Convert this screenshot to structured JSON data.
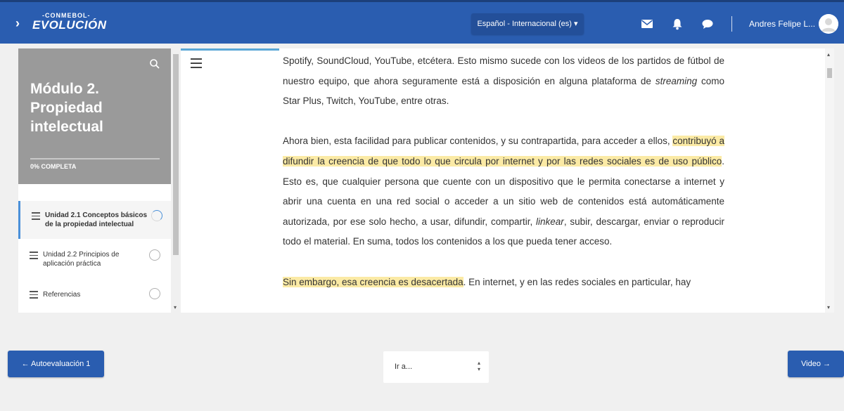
{
  "header": {
    "logo_top": "-CONMEBOL-",
    "logo_main": "EVOLUCIÓN",
    "collapse_icon": "›",
    "language": "Español - Internacional (es)",
    "language_caret": "▾",
    "username": "Andres Felipe L...",
    "icons": [
      "mail-icon",
      "bell-icon",
      "chat-icon"
    ],
    "brand_color": "#2a5db0"
  },
  "sidebar": {
    "title": "Módulo 2. Propiedad intelectual",
    "progress_label": "0% COMPLETA",
    "progress": 0,
    "items": [
      {
        "label": "Unidad 2.1 Conceptos básicos de la propiedad intelectual",
        "active": true,
        "status": "in-progress"
      },
      {
        "label": "Unidad 2.2 Principios de aplicación práctica",
        "active": false,
        "status": "not-started"
      },
      {
        "label": "Referencias",
        "active": false,
        "status": "not-started"
      }
    ],
    "scroll_down": "▾"
  },
  "content": {
    "p1_a": "Spotify, SoundCloud, YouTube, etcétera. Esto mismo sucede con los videos de los partidos de fútbol de nuestro equipo, que ahora seguramente está a disposición en alguna plataforma de ",
    "p1_em": "streaming",
    "p1_b": " como Star Plus, Twitch, YouTube, entre otras.",
    "p2_a": "Ahora bien, esta facilidad para publicar contenidos, y su contrapartida, para acceder a ellos, ",
    "p2_hl": "contribuyó a difundir la creencia de que todo lo que circula por internet y por las redes sociales es de uso público",
    "p2_b": ". Esto es, que cualquier persona que cuente con un dispositivo que le permita conectarse a internet y abrir una cuenta en una red social o acceder a un sitio web de contenidos está automáticamente autorizada, por ese solo hecho, a usar, difundir, compartir, ",
    "p2_em": "linkear",
    "p2_c": ", subir, descargar, enviar o reproducir todo el material. En suma, todos los contenidos a los que pueda tener acceso.",
    "p3_hl": "Sin embargo, esa creencia es desacertada",
    "p3_b": ". En internet, y en las redes sociales en particular, hay",
    "highlight_color": "#fbeaa5",
    "scroll_up": "▴",
    "scroll_down": "▾"
  },
  "nav": {
    "prev_label": "← Autoevaluación 1",
    "next_label": "Video →",
    "select_label": "Ir a...",
    "select_caret_up": "▴",
    "select_caret_down": "▾"
  }
}
